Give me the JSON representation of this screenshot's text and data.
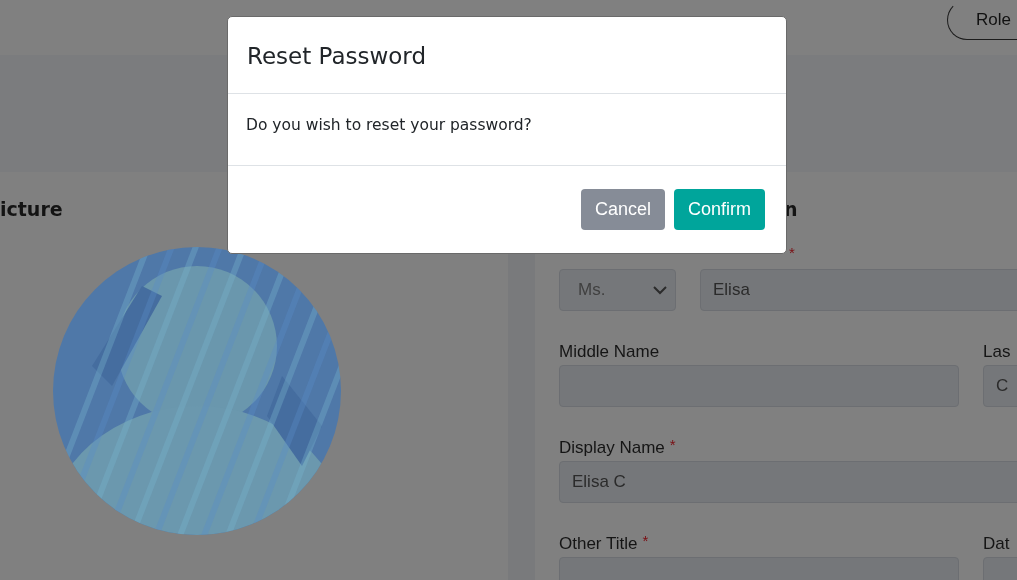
{
  "header": {
    "role_button": "Role"
  },
  "profile_picture": {
    "heading": "icture"
  },
  "form": {
    "heading": "n",
    "rows": [
      [
        {
          "kind": "select",
          "value": "Ms."
        },
        {
          "kind": "text",
          "required_mark": "*",
          "value": "Elisa"
        }
      ],
      [
        {
          "kind": "text",
          "label": "Middle Name"
        },
        {
          "kind": "text",
          "label": "Las",
          "value": "C"
        }
      ],
      [
        {
          "kind": "text",
          "label": "Display Name",
          "required_mark": "*",
          "value": "Elisa C"
        }
      ],
      [
        {
          "kind": "text",
          "label": "Other Title",
          "required_mark": "*"
        },
        {
          "kind": "text",
          "label": "Dat"
        }
      ]
    ]
  },
  "dialog": {
    "title": "Reset Password",
    "message": "Do you wish to reset your password?",
    "buttons": [
      {
        "kind": "secondary",
        "label": "Cancel"
      },
      {
        "kind": "primary",
        "label": "Confirm"
      }
    ]
  }
}
